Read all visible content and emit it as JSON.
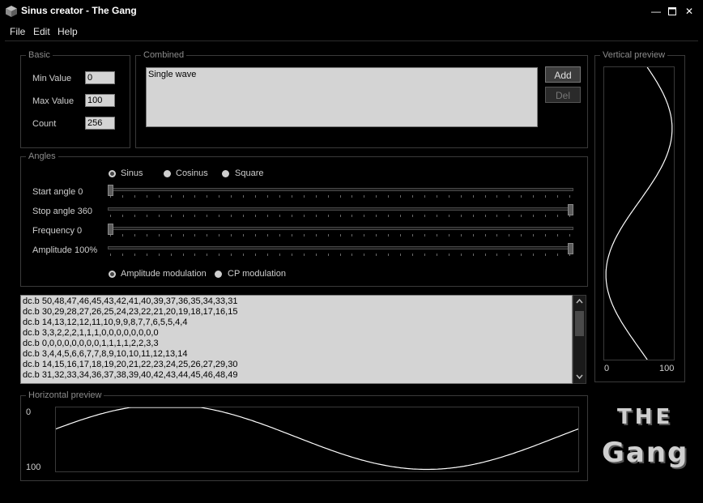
{
  "window": {
    "title": "Sinus creator - The Gang",
    "controls": [
      "minimize-icon",
      "maximize-icon",
      "close-icon"
    ]
  },
  "menu": [
    "File",
    "Edit",
    "Help"
  ],
  "basic": {
    "legend": "Basic",
    "min_label": "Min Value",
    "min_value": "0",
    "max_label": "Max Value",
    "max_value": "100",
    "count_label": "Count",
    "count_value": "256"
  },
  "combined": {
    "legend": "Combined",
    "items": [
      "Single wave"
    ],
    "add_label": "Add",
    "del_label": "Del"
  },
  "angles": {
    "legend": "Angles",
    "wave_types": [
      {
        "label": "Sinus",
        "selected": true
      },
      {
        "label": "Cosinus",
        "selected": false
      },
      {
        "label": "Square",
        "selected": false
      }
    ],
    "sliders": [
      {
        "label": "Start angle 0",
        "value": 0
      },
      {
        "label": "Stop angle 360",
        "value": 1
      },
      {
        "label": "Frequency 0",
        "value": 0
      },
      {
        "label": "Amplitude 100%",
        "value": 1
      }
    ],
    "modulations": [
      {
        "label": "Amplitude modulation",
        "selected": true
      },
      {
        "label": "CP modulation",
        "selected": false
      }
    ]
  },
  "output_lines": [
    "dc.b 50,48,47,46,45,43,42,41,40,39,37,36,35,34,33,31",
    "dc.b 30,29,28,27,26,25,24,23,22,21,20,19,18,17,16,15",
    "dc.b 14,13,12,12,11,10,9,9,8,7,7,6,5,5,4,4",
    "dc.b 3,3,2,2,2,1,1,1,0,0,0,0,0,0,0,0",
    "dc.b 0,0,0,0,0,0,0,0,1,1,1,1,2,2,3,3",
    "dc.b 3,4,4,5,6,6,7,7,8,9,10,10,11,12,13,14",
    "dc.b 14,15,16,17,18,19,20,21,22,23,24,25,26,27,29,30",
    "dc.b 31,32,33,34,36,37,38,39,40,42,43,44,45,46,48,49"
  ],
  "vertical_preview": {
    "legend": "Vertical preview",
    "min_label": "0",
    "max_label": "100"
  },
  "horizontal_preview": {
    "legend": "Horizontal preview",
    "top_label": "0",
    "bottom_label": "100"
  },
  "logo": {
    "line1": "THE",
    "line2": "Gang"
  },
  "colors": {
    "background": "#000000",
    "text": "#d4d4d4",
    "field_bg": "#d4d4d4",
    "curve": "#ffffff"
  }
}
